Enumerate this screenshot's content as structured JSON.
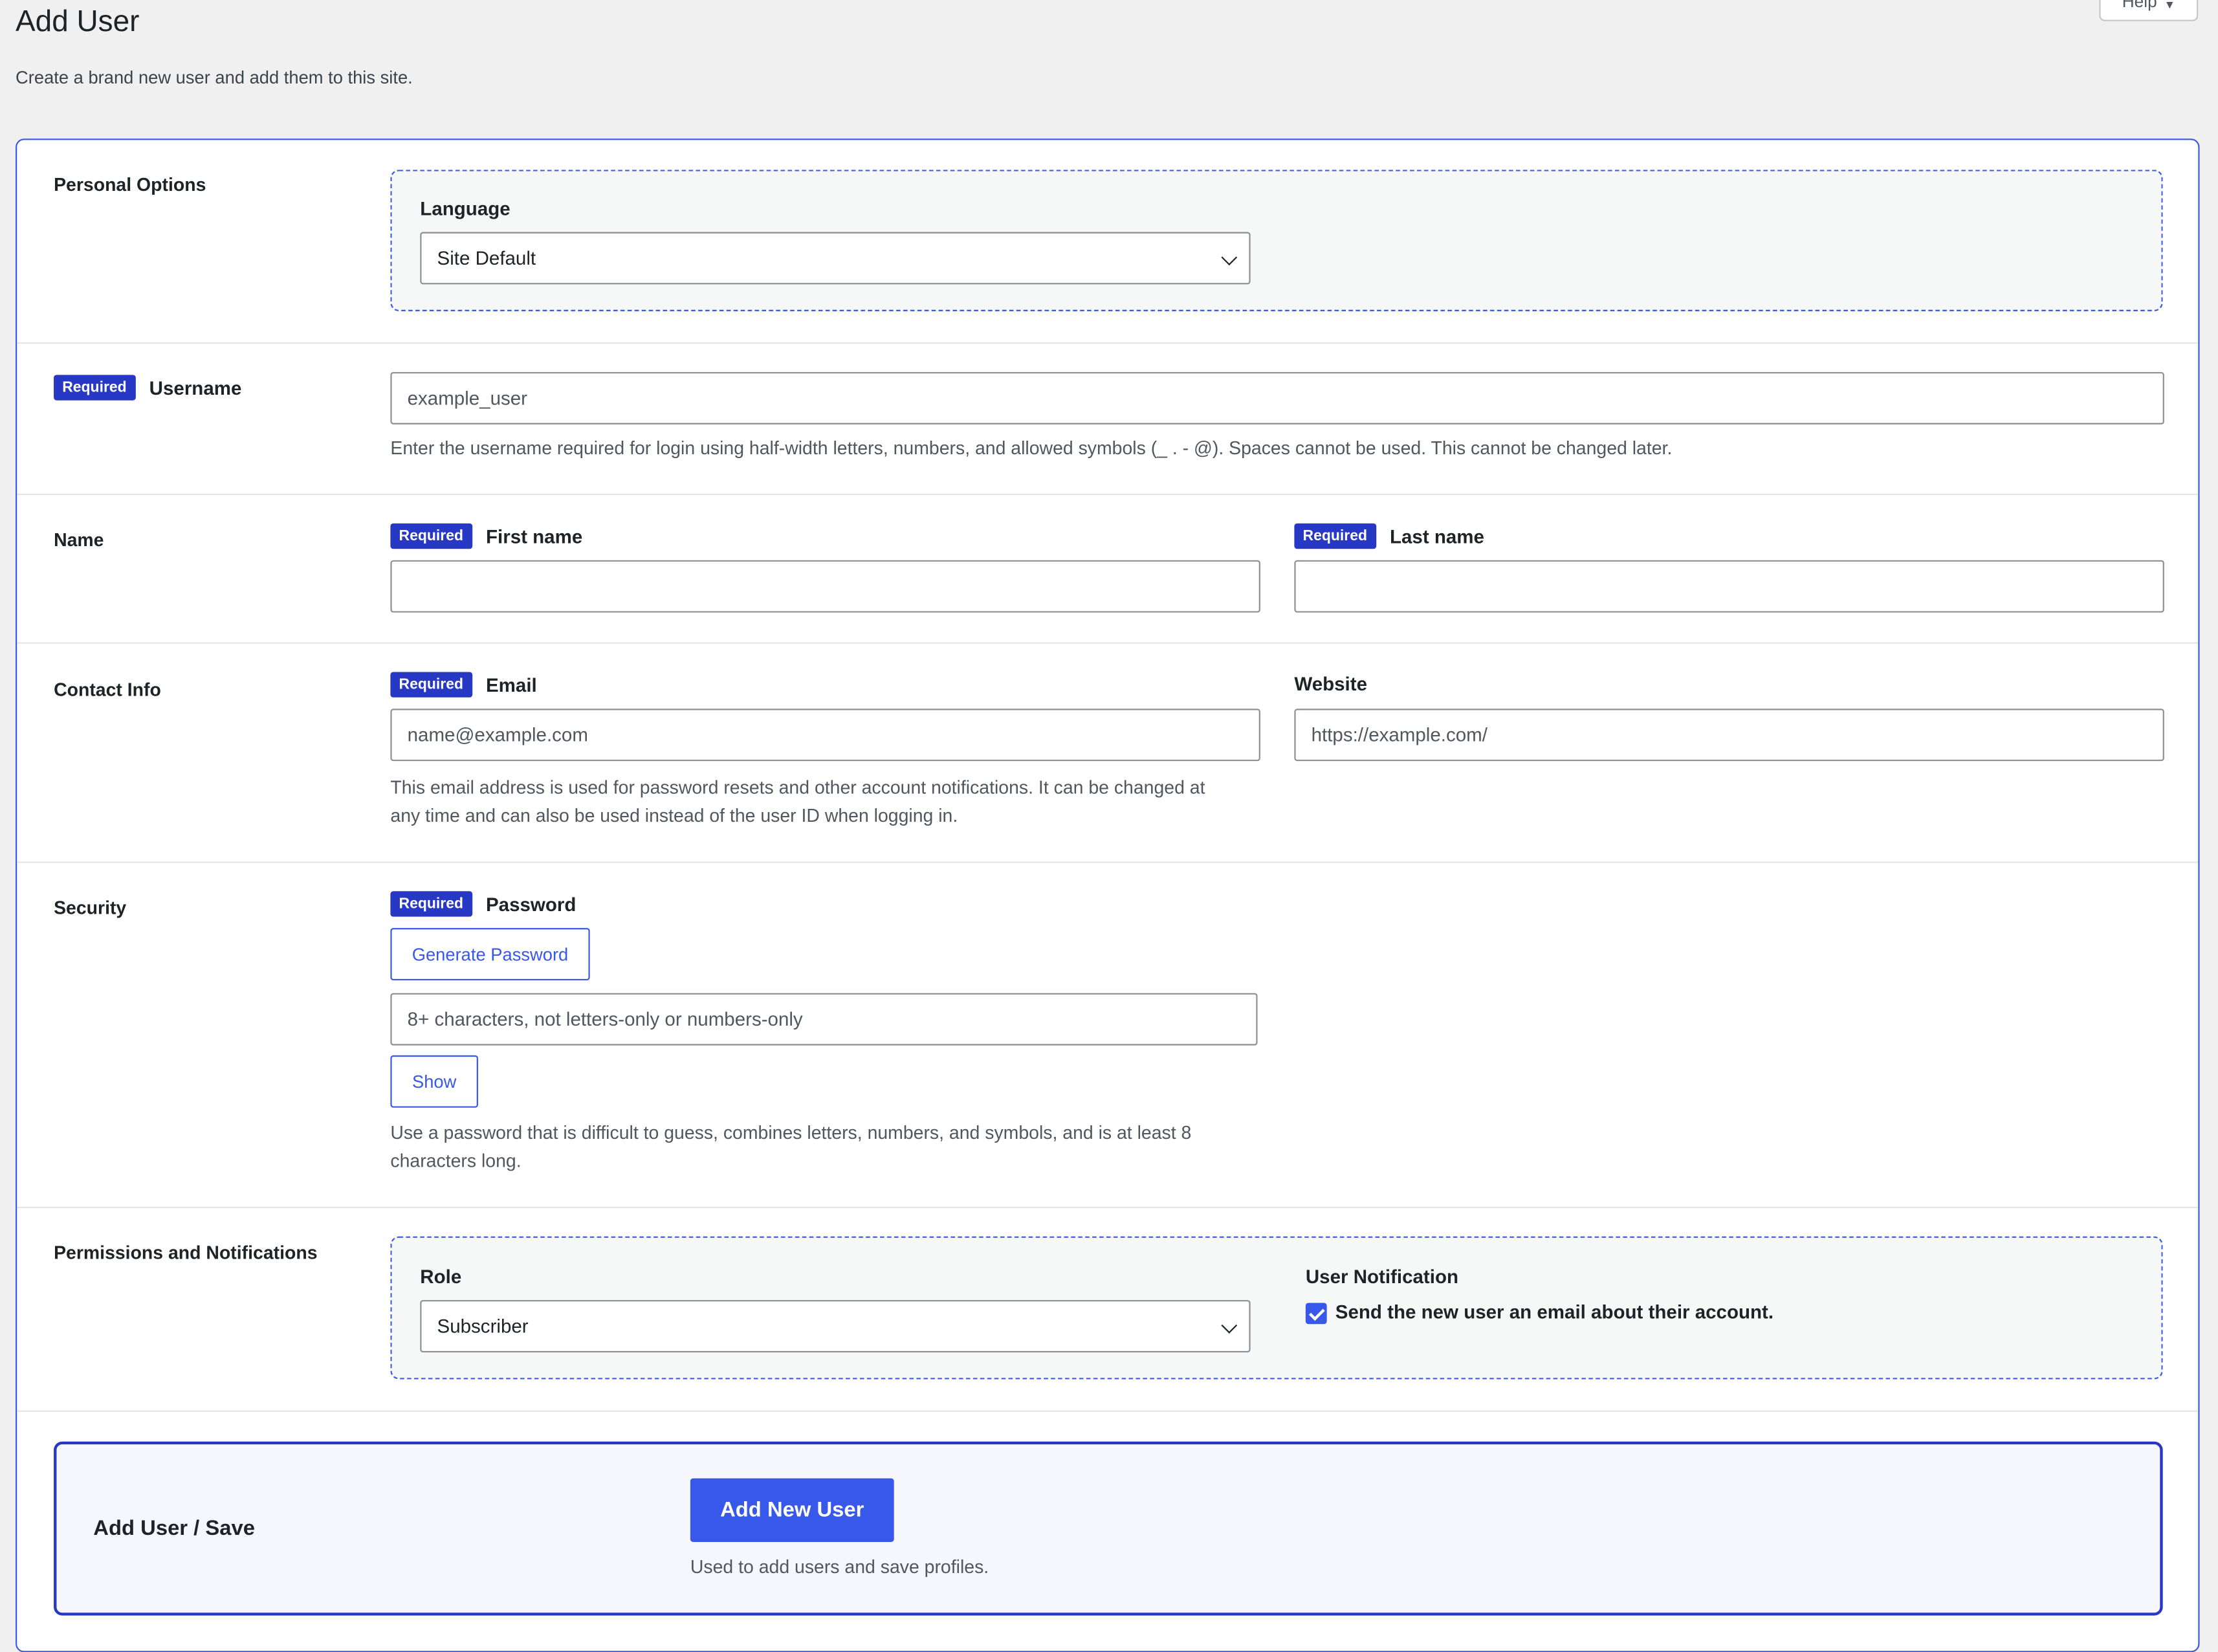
{
  "page": {
    "title": "Add User",
    "subtitle": "Create a brand new user and add them to this site.",
    "help_label": "Help"
  },
  "badge": {
    "required": "Required"
  },
  "personal": {
    "label": "Personal Options",
    "language_label": "Language",
    "language_value": "Site Default"
  },
  "username": {
    "label": "Username",
    "placeholder": "example_user",
    "help": "Enter the username required for login using half-width letters, numbers, and allowed symbols (_ . - @). Spaces cannot be used. This cannot be changed later."
  },
  "name": {
    "label": "Name",
    "first_label": "First name",
    "last_label": "Last name"
  },
  "contact": {
    "label": "Contact Info",
    "email_label": "Email",
    "email_placeholder": "name@example.com",
    "email_help": "This email address is used for password resets and other account notifications. It can be changed at any time and can also be used instead of the user ID when logging in.",
    "website_label": "Website",
    "website_placeholder": "https://example.com/"
  },
  "security": {
    "label": "Security",
    "password_label": "Password",
    "generate_label": "Generate Password",
    "password_placeholder": "8+ characters, not letters-only or numbers-only",
    "show_label": "Show",
    "help": "Use a password that is difficult to guess, combines letters, numbers, and symbols, and is at least 8 characters long."
  },
  "permissions": {
    "label": "Permissions and Notifications",
    "role_label": "Role",
    "role_value": "Subscriber",
    "notification_label": "User Notification",
    "notification_text": "Send the new user an email about their account.",
    "notification_checked": true
  },
  "save": {
    "label": "Add User / Save",
    "button_label": "Add New User",
    "help": "Used to add users and save profiles."
  },
  "colors": {
    "accent": "#3858e9",
    "badge": "#2638c4",
    "background": "#f0f0f1"
  }
}
